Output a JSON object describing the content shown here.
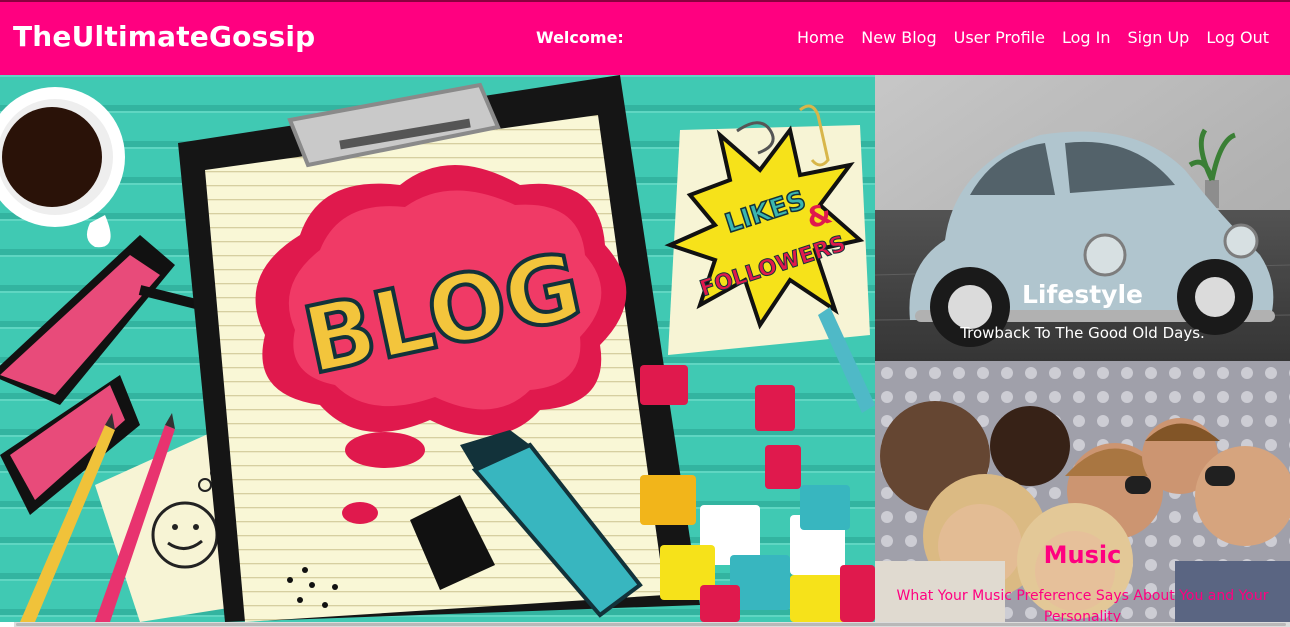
{
  "navbar": {
    "brand": "TheUltimateGossip",
    "welcome": "Welcome:",
    "links": [
      "Home",
      "New Blog",
      "User Profile",
      "Log In",
      "Sign Up",
      "Log Out"
    ]
  },
  "hero": {
    "image_text": {
      "blog": "BLOG",
      "likes": "LIKES",
      "and": "&",
      "followers": "FOLLOWERS"
    }
  },
  "cards": [
    {
      "title": "Lifestyle",
      "subtitle": "Trowback To The Good Old Days.",
      "color": "#ffffff"
    },
    {
      "title": "Music",
      "subtitle": "What Your Music Preference Says About You and Your Personality",
      "color": "#ff0080"
    }
  ],
  "colors": {
    "brand": "#ff0080",
    "teal": "#40c9b3"
  }
}
